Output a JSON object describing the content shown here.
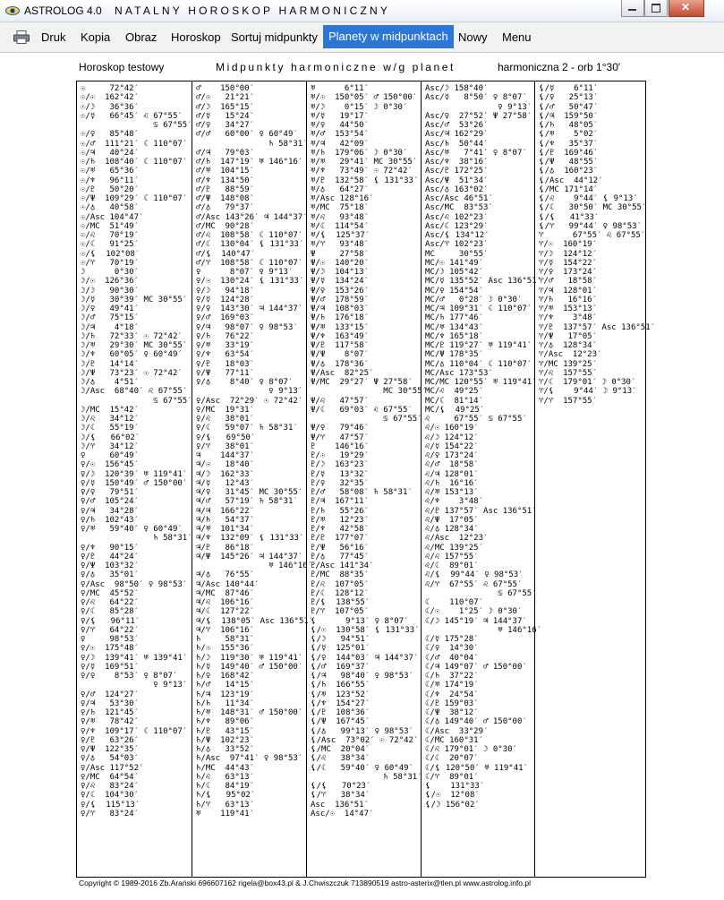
{
  "window": {
    "app_name": "ASTROLOG 4.0",
    "title": "NATALNY HOROSKOP HARMONICZNY",
    "close_label": "✕"
  },
  "menu": {
    "items": [
      "Druk",
      "Kopia",
      "Obraz",
      "Horoskop",
      "Sortuj midpunkty",
      "Planety w midpunktach",
      "Nowy",
      "Menu"
    ],
    "active_index": 5
  },
  "header": {
    "chart_name": "Horoskop testowy",
    "report_title": "Midpunkty harmoniczne w/g planet",
    "harmonic": "harmoniczna 2 - orb 1°30′"
  },
  "columns": [
    {
      "lines": [
        "☉     72°42′",
        "☉/☉  162°42′",
        "☉/☽   36°36′",
        "☉/☿   66°45′ ♌ 67°55′",
        "               ♋ 67°55′",
        "☉/♀   85°48′",
        "☉/♂  111°21′ ☾ 110°07′",
        "☉/♃   40°24′",
        "☉/♄  108°40′ ☾ 110°07′",
        "☉/♅   65°36′",
        "☉/♆   96°11′",
        "☉/♇   50°20′",
        "☉/Ψ  109°29′ ☾ 110°07′",
        "☉/♁   40°58′",
        "☉/Asc 104°47′",
        "☉/MC  51°49′",
        "☉/♌   70°19′",
        "☉/☾   91°25′",
        "☉/⚸  102°08′",
        "☉/♈   70°19′",
        "☽      0°30′",
        "☽/☉  126°36′",
        "☽/☽   90°30′",
        "☽/☿   30°39′ MC 30°55′",
        "☽/♀   49°41′",
        "☽/♂   75°15′",
        "☽/♃    4°18′",
        "☽/♄   72°33′ ☉ 72°42′",
        "☽/♅   29°30′ MC 30°55′",
        "☽/♆   60°05′ ♀ 60°49′",
        "☽/♇   14°14′",
        "☽/Ψ   73°23′ ☉ 72°42′",
        "☽/♁    4°51′",
        "☽/Asc  68°40′ ♌ 67°55′",
        "               ♋ 67°55′",
        "☽/MC  15°42′",
        "☽/♌   34°12′",
        "☽/☾   55°19′",
        "☽/⚸   66°02′",
        "☽/♈   34°12′",
        "♀     60°49′",
        "♀/☉  156°45′",
        "♀/☽  120°39′ ♅ 119°41′",
        "♀/☿  150°49′ ♂ 150°00′",
        "♀/♀   79°51′",
        "♀/♂  105°24′",
        "♀/♃   34°28′",
        "♀/♄  102°43′",
        "♀/♅   59°40′ ♀ 60°49′",
        "               ♄ 58°31′",
        "♀/♆   90°15′",
        "♀/♇   44°24′",
        "♀/Ψ  103°32′",
        "♀/♁   35°01′",
        "♀/Asc  98°50′ ♀ 98°53′",
        "♀/MC  45°52′",
        "♀/♌   64°22′",
        "♀/☾   85°28′",
        "♀/⚸   96°11′",
        "♀/♈   64°22′",
        "♀     98°53′",
        "♀/☉  175°48′",
        "♀/☽  139°41′ ♅ 139°41′",
        "♀/☿  169°51′",
        "♀/♀    8°53′ ♀ 8°07′",
        "               ♀ 9°13′",
        "♀/♂  124°27′",
        "♀/♃   53°30′",
        "♀/♄  121°45′",
        "♀/♅   78°42′",
        "♀/♆  109°17′ ☾ 110°07′",
        "♀/♇   63°26′",
        "♀/Ψ  122°35′",
        "♀/♁   54°03′",
        "♀/Asc 117°52′",
        "♀/MC  64°54′",
        "♀/♌   83°24′",
        "♀/☾  104°30′",
        "♀/⚸  115°13′",
        "♀/♈   83°24′"
      ]
    },
    {
      "lines": [
        "♂    150°00′",
        "♂/☉   21°21′",
        "♂/☽  165°15′",
        "♂/☿   15°24′",
        "♂/♀   34°27′",
        "♂/♂   60°00′ ♀ 60°49′",
        "               ♄ 58°31′",
        "♂/♃   79°03′",
        "♂/♄  147°19′ ♅ 146°16′",
        "♂/♅  104°15′",
        "♂/♆  134°50′",
        "♂/♇   88°59′",
        "♂/Ψ  148°08′",
        "♂/♁   79°37′",
        "♂/Asc 143°26′ ♃ 144°37′",
        "♂/MC  90°28′",
        "♂/♌  108°58′ ☾ 110°07′",
        "♂/☾  130°04′ ⚸ 131°33′",
        "♂/⚸  140°47′",
        "♂/♈  108°58′ ☾ 110°07′",
        "♀      8°07′ ♀ 9°13′",
        "♀/☉  130°24′ ⚸ 131°33′",
        "♀/☽   94°18′",
        "♀/☿  124°28′",
        "♀/♀  143°30′ ♃ 144°37′",
        "♀/♂  169°03′",
        "♀/♃   98°07′ ♀ 98°53′",
        "♀/♄   76°22′",
        "♀/♅   33°19′",
        "♀/♆   63°54′",
        "♀/♇   18°03′",
        "♀/Ψ   77°11′",
        "♀/♁    8°40′ ♀ 8°07′",
        "               ♀ 9°13′",
        "♀/Asc  72°29′ ☉ 72°42′",
        "♀/MC  19°31′",
        "♀/♌   38°01′",
        "♀/☾   59°07′ ♄ 58°31′",
        "♀/⚸   69°50′",
        "♀/♈   38°01′",
        "♃    144°37′",
        "♃/☉   18°40′",
        "♃/☽  162°33′",
        "♃/☿   12°43′",
        "♃/♀   31°45′ MC 30°55′",
        "♃/♂   57°19′ ♄ 58°31′",
        "♃/♃  166°22′",
        "♃/♄   54°37′",
        "♃/♅  101°34′",
        "♃/♆  132°09′ ⚸ 131°33′",
        "♃/♇   86°18′",
        "♃/Ψ  145°26′ ♃ 144°37′",
        "               ♅ 146°16′",
        "♃/♁   76°55′",
        "♃/Asc 140°44′",
        "♃/MC  87°46′",
        "♃/♌  106°16′",
        "♃/☾  127°22′",
        "♃/⚸  138°05′ Asc 136°51′",
        "♃/♈  106°16′",
        "♄     58°31′",
        "♄/☉  155°36′",
        "♄/☽  119°30′ ♅ 119°41′",
        "♄/☿  149°40′ ♂ 150°00′",
        "♄/♀  168°42′",
        "♄/♂   14°15′",
        "♄/♃  123°19′",
        "♄/♄   11°34′",
        "♄/♅  148°31′ ♂ 150°00′",
        "♄/♆   89°06′",
        "♄/♇   43°15′",
        "♄/Ψ  102°23′",
        "♄/♁   33°52′",
        "♄/Asc  97°41′ ♀ 98°53′",
        "♄/MC  44°43′",
        "♄/♌   63°13′",
        "♄/☾   84°19′",
        "♄/⚸   95°02′",
        "♄/♈   63°13′",
        "♅    119°41′"
      ]
    },
    {
      "lines": [
        "♅      6°11′",
        "♅/☉  150°05′ ♂ 150°00′",
        "♅/☽    0°15′ ☽ 0°30′",
        "♅/☿   19°17′",
        "♅/♀   44°50′",
        "♅/♂  153°54′",
        "♅/♃   42°09′",
        "♅/♄  179°06′ ☽ 0°30′",
        "♅/♅   29°41′ MC 30°55′",
        "♅/♆   73°49′ ☉ 72°42′",
        "♅/♇  132°58′ ⚸ 131°33′",
        "♅/♁   64°27′",
        "♅/Asc 128°16′",
        "♅/MC  75°18′",
        "♅/♌   93°48′",
        "♅/☾  114°54′",
        "♅/⚸  125°37′",
        "♅/♈   93°48′",
        "Ψ     27°58′",
        "Ψ/☉  140°20′",
        "Ψ/☽  104°13′",
        "Ψ/☿  134°24′",
        "Ψ/♀  153°26′",
        "Ψ/♂  178°59′",
        "Ψ/♃  108°03′",
        "Ψ/♄  176°18′",
        "Ψ/♅  133°15′",
        "Ψ/♆  163°49′",
        "Ψ/♇  117°58′",
        "Ψ/Ψ    8°07′",
        "Ψ/♁  178°36′",
        "Ψ/Asc  82°25′",
        "Ψ/MC  29°27′ Ψ 27°58′",
        "               MC 30°55′",
        "Ψ/♌   47°57′",
        "Ψ/☾   69°03′ ♌ 67°55′",
        "               ♋ 67°55′",
        "Ψ/♀   79°46′",
        "Ψ/♈   47°57′",
        "♇    146°16′",
        "♇/☉   19°29′",
        "♇/☽  163°23′",
        "♇/☿   13°32′",
        "♇/♀   32°35′",
        "♇/♂   58°08′ ♄ 58°31′",
        "♇/♃  167°11′",
        "♇/♄   55°26′",
        "♇/♅   12°23′",
        "♇/♆   42°58′",
        "♇/♇  177°07′",
        "♇/Ψ   56°16′",
        "♇/♁   77°45′",
        "♇/Asc 141°34′",
        "♇/MC  88°35′",
        "♇/♌  107°05′",
        "♇/☾  128°12′",
        "♇/⚸  138°55′",
        "♇/♈  107°05′",
        "⚸      9°13′ ♀ 8°07′",
        "⚸/☉  130°58′ ⚸ 131°33′",
        "⚸/☽   94°51′",
        "⚸/☿  125°01′",
        "⚸/♀  144°03′ ♃ 144°37′",
        "⚸/♂  169°37′",
        "⚸/♃   98°40′ ♀ 98°53′",
        "⚸/♄  166°55′",
        "⚸/♅  123°52′",
        "⚸/♆  154°27′",
        "⚸/♇  108°36′",
        "⚸/Ψ  167°45′",
        "⚸/♁   99°13′ ♀ 98°53′",
        "⚸/Asc  73°02′ ☉ 72°42′",
        "⚸/MC  20°04′",
        "⚸/♌   38°34′",
        "⚸/☾   59°40′ ♀ 60°49′",
        "               ♄ 58°31′",
        "⚸/⚸   70°23′",
        "⚸/♈   38°34′",
        "Asc  136°51′",
        "Asc/☉  14°47′"
      ]
    },
    {
      "lines": [
        "Asc/☽ 158°40′",
        "Asc/☿   8°50′ ♀ 8°07′",
        "               ♀ 9°13′",
        "Asc/♀  27°52′ Ψ 27°58′",
        "Asc/♂  53°26′",
        "Asc/♃ 162°29′",
        "Asc/♄  50°44′",
        "Asc/♅   7°41′ ♀ 8°07′",
        "Asc/♆  38°16′",
        "Asc/♇ 172°25′",
        "Asc/Ψ  51°34′",
        "Asc/♁ 163°02′",
        "Asc/Asc 46°51′",
        "Asc/MC  83°53′",
        "Asc/♌ 102°23′",
        "Asc/☾ 123°29′",
        "Asc/⚸ 134°12′",
        "Asc/♈ 102°23′",
        "MC     30°55′",
        "MC/☉ 141°49′",
        "MC/☽ 105°42′",
        "MC/☿ 135°52′ Asc 136°51′",
        "MC/♀ 154°54′",
        "MC/♂   0°28′ ☽ 0°30′",
        "MC/♃ 109°31′ ☾ 110°07′",
        "MC/♄ 177°46′",
        "MC/♅ 134°43′",
        "MC/♆ 165°18′",
        "MC/♇ 119°27′ ♅ 119°41′",
        "MC/Ψ 178°35′",
        "MC/♁ 110°04′ ☾ 110°07′",
        "MC/Asc 173°53′",
        "MC/MC 120°55′ ♅ 119°41′",
        "MC/♌  49°25′",
        "MC/☾  81°14′",
        "MC/⚸  49°25′",
        "♌     67°55′ ♋ 67°55′",
        "♌/☉ 160°19′",
        "♌/☽ 124°12′",
        "♌/☿ 154°22′",
        "♌/♀ 173°24′",
        "♌/♂  18°58′",
        "♌/♃ 128°01′",
        "♌/♄  16°16′",
        "♌/♅ 153°13′",
        "♌/♆    3°48′",
        "♌/♇ 137°57′ Asc 136°51′",
        "♌/Ψ  17°05′",
        "♌/♁ 128°34′",
        "♌/Asc  12°23′",
        "♌/MC 139°25′",
        "♌/♌ 157°55′",
        "♌/☾  89°01′",
        "♌/⚸  99°44′ ♀ 98°53′",
        "♌/♈  67°55′ ♌ 67°55′",
        "               ♋ 67°55′",
        "☾    110°07′",
        "☾/☉    1°25′ ☽ 0°30′",
        "☾/☽ 145°19′ ♃ 144°37′",
        "               ♅ 146°16′",
        "☾/☿ 175°28′",
        "☾/♀  14°30′",
        "☾/♂  40°04′",
        "☾/♃ 149°07′ ♂ 150°00′",
        "☾/♄  37°22′",
        "☾/♅ 174°19′",
        "☾/♆  24°54′",
        "☾/♇ 159°03′",
        "☾/Ψ  38°12′",
        "☾/♁ 149°40′ ♂ 150°00′",
        "☾/Asc  33°29′",
        "☾/MC 160°31′",
        "☾/♌ 179°01′ ☽ 0°30′",
        "☾/☾  20°07′",
        "☾/⚸ 120°50′ ♅ 119°41′",
        "☾/♈  89°01′",
        "⚸    131°33′",
        "⚸/☉  12°08′",
        "⚸/☽ 156°02′"
      ]
    },
    {
      "lines": [
        "⚸/☿    6°11′",
        "⚸/♀   25°13′",
        "⚸/♂   50°47′",
        "⚸/♃  159°50′",
        "⚸/♄   48°05′",
        "⚸/♅    5°02′",
        "⚸/♆   35°37′",
        "⚸/♇  169°46′",
        "⚸/Ψ   48°55′",
        "⚸/♁  160°23′",
        "⚸/Asc  44°12′",
        "⚸/MC 171°14′",
        "⚸/♌    9°44′ ⚸ 9°13′",
        "⚸/☾   30°50′ MC 30°55′",
        "⚸/⚸   41°33′",
        "⚸/♈   99°44′ ♀ 98°53′",
        "♈      67°55′ ♌ 67°55′",
        "♈/☉  160°19′",
        "♈/☽  124°12′",
        "♈/☿  154°22′",
        "♈/♀  173°24′",
        "♈/♂   18°58′",
        "♈/♃  128°01′",
        "♈/♄   16°16′",
        "♈/♅  153°13′",
        "♈/♆    3°48′",
        "♈/♇  137°57′ Asc 136°51′",
        "♈/Ψ   17°05′",
        "♈/♁  128°34′",
        "♈/Asc  12°23′",
        "♈/MC 139°25′",
        "♈/♌  157°55′",
        "♈/☾  179°01′ ☽ 0°30′",
        "♈/⚸    9°44′ ☽ 9°13′",
        "♈/♈  157°55′"
      ]
    }
  ],
  "footer": {
    "text": "Copyright © 1989-2016 Zb.Arański 696607162 rigela@box43.pl & J.Chwiszczuk 713890519 astro-asterix@tlen.pl www.astrolog.info.pl"
  }
}
